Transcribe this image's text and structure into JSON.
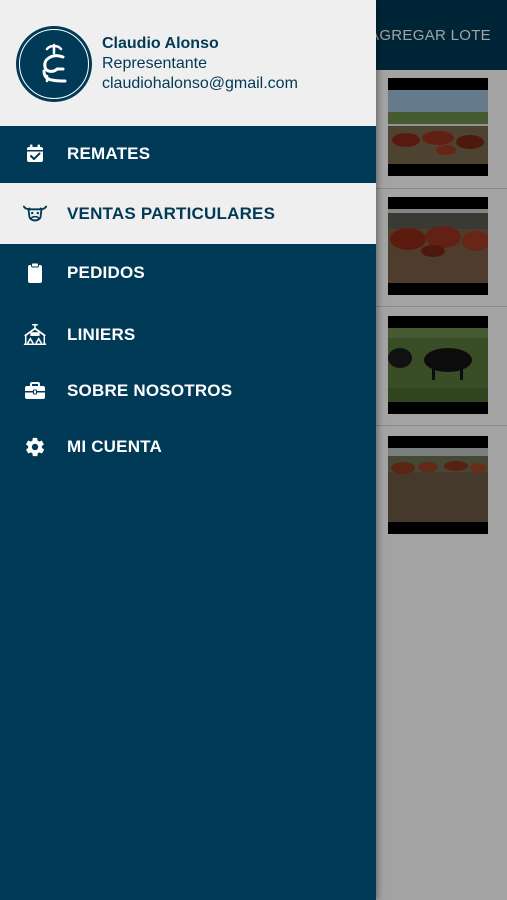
{
  "background": {
    "topbar": {
      "action_label": "AGREGAR LOTE"
    },
    "cards": [
      {
        "image": "cattle-in-corral-photo"
      },
      {
        "image": "red-cattle-photo"
      },
      {
        "image": "black-cattle-field-photo"
      },
      {
        "image": "herd-in-pasture-photo"
      }
    ]
  },
  "drawer": {
    "user": {
      "name": "Claudio Alonso",
      "role": "Representante",
      "email": "claudiohalonso@gmail.com",
      "avatar_icon": "brand-logo-icon"
    },
    "items": [
      {
        "label": "REMATES",
        "icon": "calendar-check-icon",
        "active": false
      },
      {
        "label": "VENTAS PARTICULARES",
        "icon": "cow-head-icon",
        "active": true
      },
      {
        "label": "PEDIDOS",
        "icon": "clipboard-icon",
        "active": false
      },
      {
        "label": "LINIERS",
        "icon": "liniers-market-icon",
        "active": false
      },
      {
        "label": "SOBRE NOSOTROS",
        "icon": "briefcase-icon",
        "active": false
      },
      {
        "label": "MI CUENTA",
        "icon": "gear-icon",
        "active": false
      }
    ]
  },
  "colors": {
    "primary": "#003a57",
    "header_bg": "#efefef",
    "active_bg": "#efefef"
  }
}
